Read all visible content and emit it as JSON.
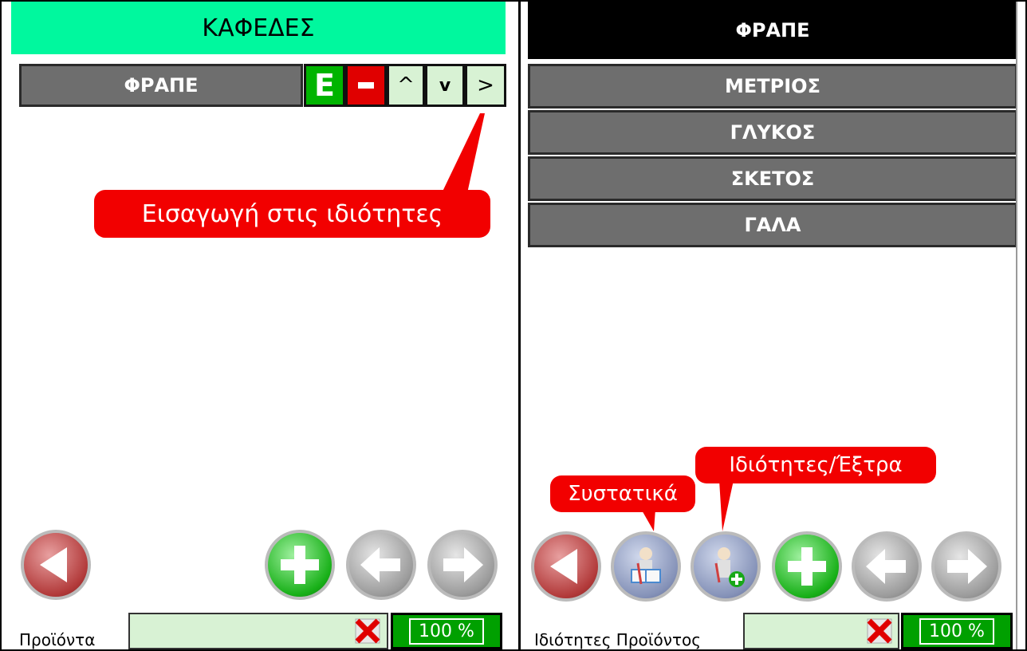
{
  "left": {
    "category_title": "ΚΑΦΕΔΕΣ",
    "item_label": "ΦΡΑΠΕ",
    "controls": {
      "e_label": "E",
      "up_label": "^",
      "down_label": "v",
      "right_label": ">"
    },
    "callout": "Εισαγωγή στις ιδιότητες",
    "status": {
      "label": "Προϊόντα",
      "zoom": "100 %"
    }
  },
  "right": {
    "title": "ΦΡΑΠΕ",
    "attributes": [
      "ΜΕΤΡΙΟΣ",
      "ΓΛΥΚΟΣ",
      "ΣΚΕΤΟΣ",
      "ΓΑΛΑ"
    ],
    "callout_ingredients": "Συστατικά",
    "callout_extras": "Ιδιότητες/Έξτρα",
    "status": {
      "label": "Ιδιότητες Προϊόντος",
      "zoom": "100 %"
    }
  },
  "colors": {
    "category_header": "#00f89e",
    "item_button": "#6e6e6e",
    "callout": "#f20000",
    "zoom_box": "#00a000",
    "field_bg": "#d8f2d4"
  },
  "icons": [
    "back-arrow-icon",
    "add-plus-icon",
    "prev-arrow-icon",
    "next-arrow-icon",
    "ingredients-icon",
    "extras-icon",
    "clear-icon"
  ]
}
